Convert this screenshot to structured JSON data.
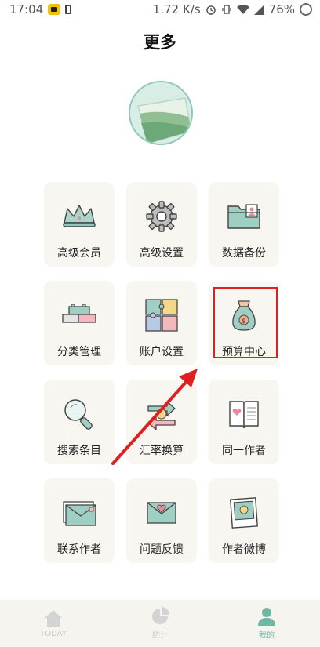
{
  "status_bar": {
    "time": "17:04",
    "speed": "1.72 K/s",
    "battery": "76%"
  },
  "page": {
    "title": "更多"
  },
  "menu_items": [
    {
      "id": "vip",
      "label": "高级会员",
      "icon": "crown-icon"
    },
    {
      "id": "settings",
      "label": "高级设置",
      "icon": "gear-icon"
    },
    {
      "id": "backup",
      "label": "数据备份",
      "icon": "folder-icon"
    },
    {
      "id": "category",
      "label": "分类管理",
      "icon": "blocks-icon"
    },
    {
      "id": "account",
      "label": "账户设置",
      "icon": "puzzle-icon"
    },
    {
      "id": "budget",
      "label": "预算中心",
      "icon": "money-bag-icon"
    },
    {
      "id": "search",
      "label": "搜索条目",
      "icon": "magnifier-icon"
    },
    {
      "id": "exchange",
      "label": "汇率换算",
      "icon": "exchange-icon"
    },
    {
      "id": "same_author",
      "label": "同一作者",
      "icon": "book-icon"
    },
    {
      "id": "contact",
      "label": "联系作者",
      "icon": "envelope-icon"
    },
    {
      "id": "feedback",
      "label": "问题反馈",
      "icon": "heart-envelope-icon"
    },
    {
      "id": "weibo",
      "label": "作者微博",
      "icon": "photo-icon"
    }
  ],
  "tabs": [
    {
      "label": "TODAY",
      "icon": "home-icon",
      "active": false
    },
    {
      "label": "统计",
      "icon": "chart-icon",
      "active": false
    },
    {
      "label": "我的",
      "icon": "person-icon",
      "active": true
    }
  ],
  "colors": {
    "card_bg": "#f7f6f1",
    "accent": "#6fb8a8",
    "highlight": "#e02020"
  }
}
